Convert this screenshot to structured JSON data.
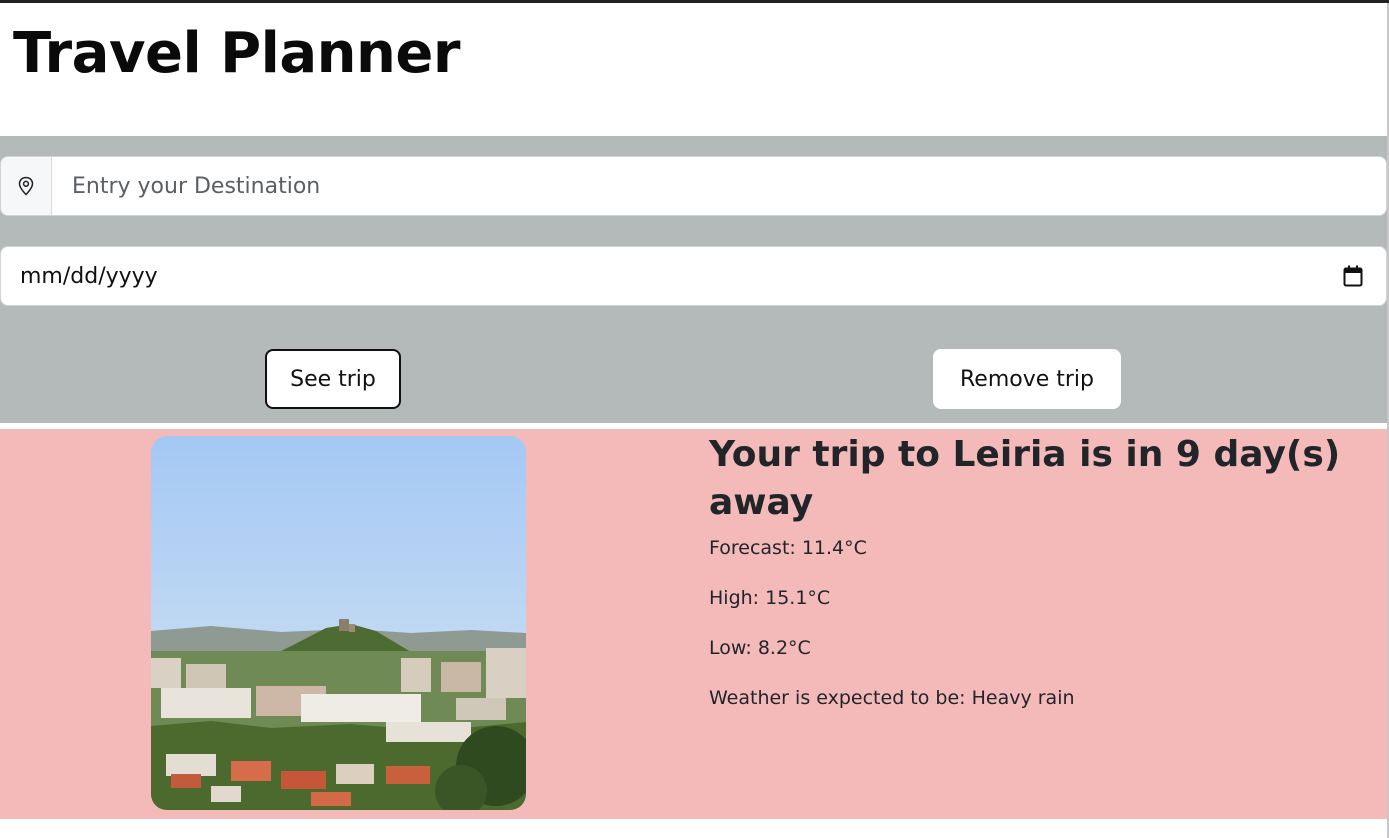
{
  "app": {
    "title": "Travel Planner"
  },
  "form": {
    "destination_placeholder": "Entry your Destination",
    "date_value": "mm/dd/yyyy",
    "see_trip_label": "See trip",
    "remove_trip_label": "Remove trip"
  },
  "trip": {
    "heading": "Your trip to Leiria is in 9 day(s) away",
    "forecast": "Forecast: 11.4°C",
    "high": "High: 15.1°C",
    "low": "Low: 8.2°C",
    "conditions": "Weather is expected to be: Heavy rain"
  },
  "icons": {
    "destination": "map-pin-icon",
    "date": "calendar-icon"
  },
  "colors": {
    "form_background": "#b4baba",
    "result_background": "#f4baba",
    "text_dark": "#212529"
  }
}
